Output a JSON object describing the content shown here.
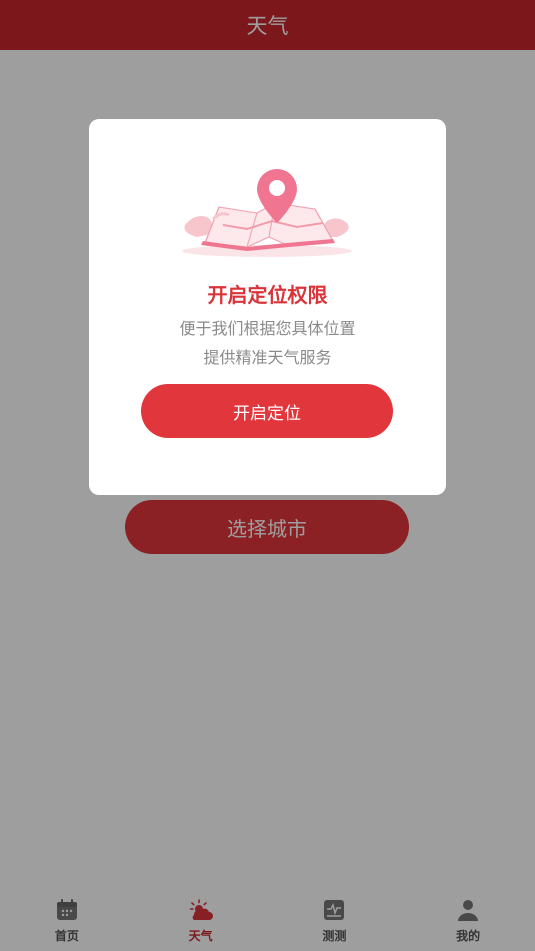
{
  "header": {
    "title": "天气"
  },
  "main": {
    "select_city_label": "选择城市"
  },
  "modal": {
    "title": "开启定位权限",
    "desc_line1": "便于我们根据您具体位置",
    "desc_line2": "提供精准天气服务",
    "button_label": "开启定位",
    "illustration": "location-map-illustration"
  },
  "tabbar": {
    "items": [
      {
        "label": "首页",
        "icon": "calendar-icon",
        "active": false
      },
      {
        "label": "天气",
        "icon": "weather-icon",
        "active": true
      },
      {
        "label": "测测",
        "icon": "chart-icon",
        "active": false
      },
      {
        "label": "我的",
        "icon": "user-icon",
        "active": false
      }
    ]
  },
  "colors": {
    "brand": "#c9282d",
    "button": "#e1363b",
    "overlay": "rgba(0,0,0,0.38)",
    "text_muted": "#8a8a8a"
  }
}
